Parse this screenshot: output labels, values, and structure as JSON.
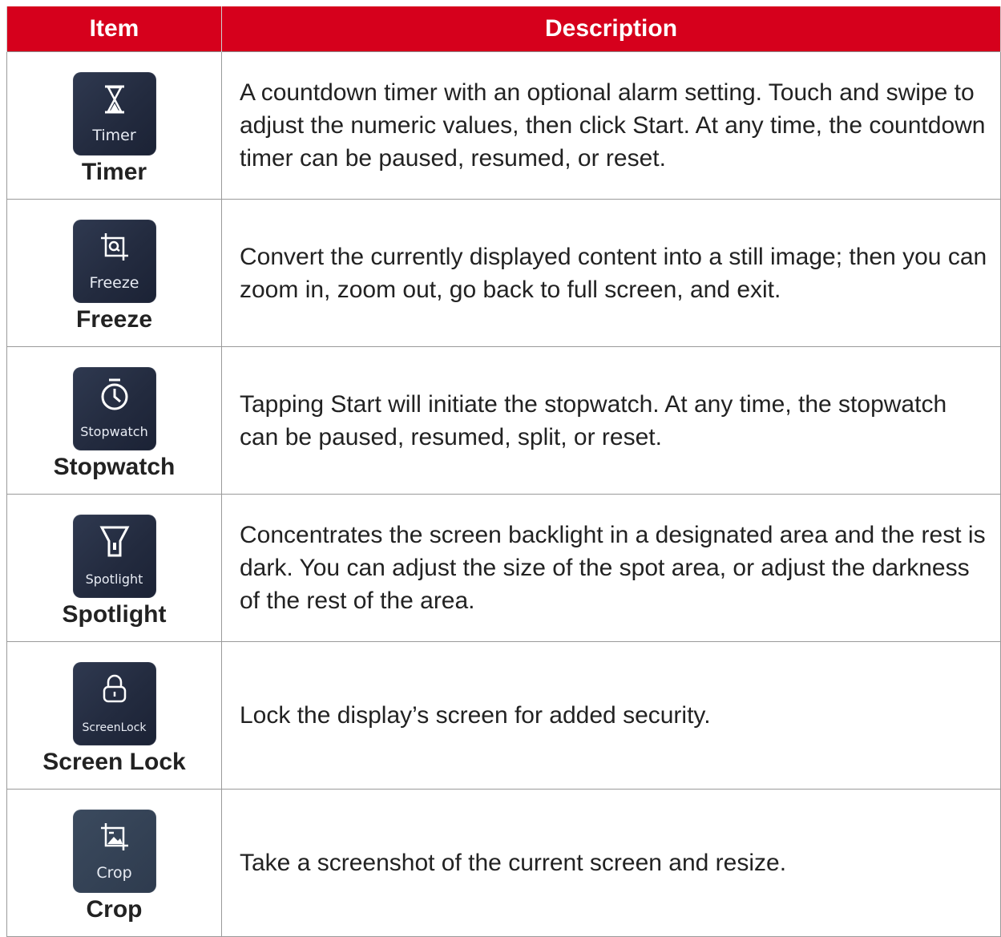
{
  "header": {
    "item": "Item",
    "description": "Description"
  },
  "rows": [
    {
      "tile_label": "Timer",
      "name": "Timer",
      "icon": "hourglass-icon",
      "description": "A countdown timer with an optional alarm setting. Touch and swipe to adjust the numeric values, then click Start. At any time, the countdown timer can be paused, resumed, or reset."
    },
    {
      "tile_label": "Freeze",
      "name": "Freeze",
      "icon": "freeze-frame-icon",
      "description": "Convert the currently displayed content into a still image; then you can zoom in, zoom out, go back to full screen, and exit."
    },
    {
      "tile_label": "Stopwatch",
      "name": "Stopwatch",
      "icon": "stopwatch-icon",
      "description": "Tapping Start will initiate the stopwatch. At any time, the stopwatch can be paused, resumed, split, or reset."
    },
    {
      "tile_label": "Spotlight",
      "name": "Spotlight",
      "icon": "spotlight-icon",
      "description": "Concentrates the screen backlight in a designated area and the rest is dark. You can adjust the size of the spot area, or adjust the darkness of the rest of the area."
    },
    {
      "tile_label": "ScreenLock",
      "name": "Screen Lock",
      "icon": "lock-icon",
      "description": "Lock the display’s screen for added security."
    },
    {
      "tile_label": "Crop",
      "name": "Crop",
      "icon": "crop-image-icon",
      "description": "Take a screenshot of the current screen and resize."
    }
  ],
  "colors": {
    "header_bg": "#d6001c",
    "tile_bg": "#262e44",
    "text": "#222222"
  }
}
